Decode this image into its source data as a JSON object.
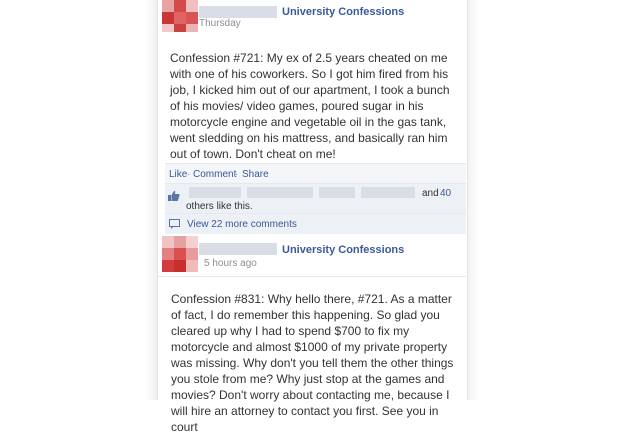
{
  "colors": {
    "link": "#3b5998",
    "text": "#333333",
    "meta": "#8e8e8e",
    "ufi_bg": "#edf0f5"
  },
  "posts": [
    {
      "page_name": "University Confessions",
      "timestamp": "Thursday",
      "body": "Confession #721: My ex of 2.5 years cheated on me with one of his coworkers. So I got him fired from his job, I kicked him out of our apartment, I took a bunch of his movies/ video games, poured sugar in his motorcycle engine and vegetable oil in the gas tank, went sledding on his mattress, and basically ran him out of town. Don't cheat on me!",
      "actions": {
        "like": "Like",
        "comment": "Comment",
        "share": "Share",
        "sep": "·"
      },
      "likes": {
        "and_text": "and",
        "others_count": "40",
        "others_text": "others like this."
      },
      "view_more": "View 22 more comments",
      "icons": {
        "like": "thumbs-up-icon",
        "comment": "comment-bubble-icon"
      }
    },
    {
      "page_name": "University Confessions",
      "timestamp": "5 hours ago",
      "body": "Confession #831: Why hello there, #721. As a matter of fact, I do remember this happening. So glad you cleared up why I had to spend $700 to fix my motorcycle and almost $1000 of my private property was missing. Why don't you tell them the other things you stole from me? Why just stop at the games and movies? Don't worry about contacting me, because I will hire an attorney to contact you first. See you in court"
    }
  ]
}
